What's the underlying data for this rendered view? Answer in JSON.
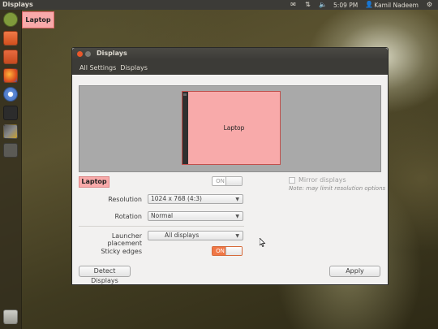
{
  "topbar": {
    "title": "Displays",
    "time": "5:09 PM",
    "user": "Kamil Nadeem",
    "icons": [
      "mail-icon",
      "network-icon",
      "volume-icon",
      "clock",
      "user-icon",
      "gear-icon"
    ]
  },
  "launcher": {
    "items": [
      "dash-icon",
      "files-icon",
      "software-center-icon",
      "firefox-icon",
      "chromium-icon",
      "terminal-icon",
      "system-settings-icon",
      "workspace-switcher-icon",
      "trash-icon"
    ]
  },
  "osd_label": "Laptop",
  "window": {
    "title": "Displays",
    "nav": {
      "all_settings": "All Settings",
      "current": "Displays"
    },
    "monitor_label": "Laptop",
    "display_name": "Laptop",
    "power_toggle": "ON",
    "mirror_label": "Mirror displays",
    "mirror_note": "Note: may limit resolution options",
    "resolution_label": "Resolution",
    "resolution_value": "1024 x 768 (4:3)",
    "rotation_label": "Rotation",
    "rotation_value": "Normal",
    "launcher_placement_label": "Launcher placement",
    "launcher_placement_value": "All displays",
    "sticky_edges_label": "Sticky edges",
    "sticky_edges_toggle": "ON",
    "detect_button": "Detect Displays",
    "apply_button": "Apply"
  },
  "colors": {
    "panel": "#3c3b37",
    "monitor_fill": "#f8aaaa",
    "monitor_border": "#c0504d",
    "sticky_on": "#f07746"
  }
}
